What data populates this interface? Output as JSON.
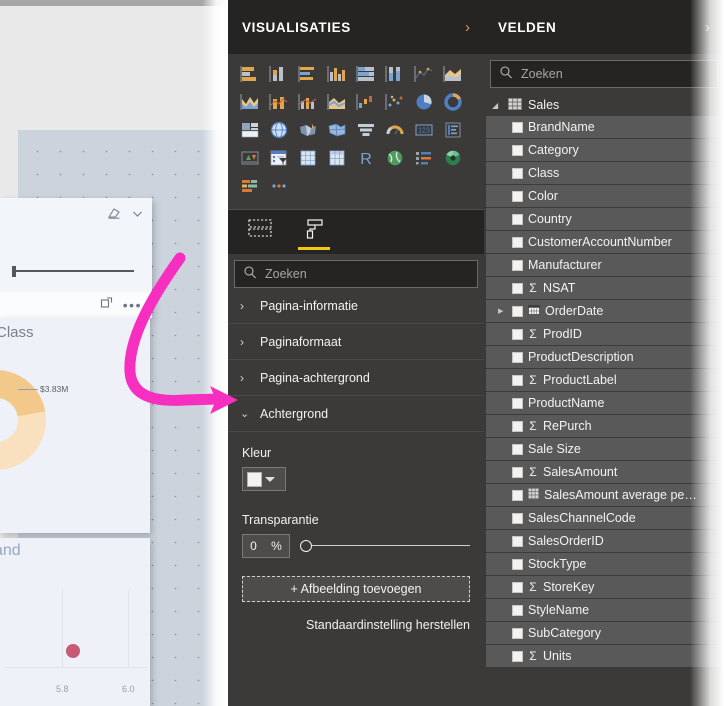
{
  "visualisaties": {
    "title": "VISUALISATIES",
    "collapse_chevron": "›",
    "gallery_icons": [
      "stacked-bar-chart-icon",
      "stacked-column-chart-icon",
      "clustered-bar-chart-icon",
      "clustered-column-chart-icon",
      "hundred-percent-stacked-bar-chart-icon",
      "hundred-percent-stacked-column-chart-icon",
      "line-chart-icon",
      "area-chart-icon",
      "stacked-area-chart-icon",
      "line-stacked-column-chart-icon",
      "line-clustered-column-chart-icon",
      "ribbon-chart-icon",
      "waterfall-chart-icon",
      "scatter-chart-icon",
      "pie-chart-icon",
      "donut-chart-icon",
      "treemap-icon",
      "map-icon",
      "filled-map-icon",
      "shape-map-icon",
      "funnel-chart-icon",
      "gauge-chart-icon",
      "card-icon",
      "multi-row-card-icon",
      "kpi-icon",
      "slicer-icon",
      "table-icon",
      "matrix-icon",
      "r-script-visual-icon",
      "arcgis-map-icon",
      "key-influencers-icon",
      "decomposition-tree-icon",
      "paginated-report-icon",
      "more-options-icon"
    ],
    "tabs": [
      {
        "name": "fields-tab",
        "icon": "fields-pane-icon",
        "active": false
      },
      {
        "name": "format-tab",
        "icon": "paint-roller-icon",
        "active": true
      }
    ],
    "search": {
      "placeholder": "Zoeken",
      "value": "",
      "icon": "search-icon"
    },
    "format_sections": [
      {
        "label": "Pagina-informatie",
        "expanded": false
      },
      {
        "label": "Paginaformaat",
        "expanded": false
      },
      {
        "label": "Pagina-achtergrond",
        "expanded": false
      },
      {
        "label": "Achtergrond",
        "expanded": true
      }
    ],
    "achtergrond": {
      "kleur_label": "Kleur",
      "kleur_value": "#FFFFFF",
      "transparantie_label": "Transparantie",
      "transparantie_value": "0",
      "transparantie_unit": "%",
      "add_image_label": "+ Afbeelding toevoegen",
      "reset_label": "Standaardinstelling herstellen"
    }
  },
  "velden": {
    "title": "VELDEN",
    "collapse_chevron": "›",
    "search": {
      "placeholder": "Zoeken",
      "value": "",
      "icon": "search-icon"
    },
    "table": {
      "name": "Sales",
      "expanded": true,
      "icon": "table-icon"
    },
    "fields": [
      {
        "label": "BrandName",
        "aggregate": false,
        "type": "column"
      },
      {
        "label": "Category",
        "aggregate": false,
        "type": "column"
      },
      {
        "label": "Class",
        "aggregate": false,
        "type": "column"
      },
      {
        "label": "Color",
        "aggregate": false,
        "type": "column"
      },
      {
        "label": "Country",
        "aggregate": false,
        "type": "column"
      },
      {
        "label": "CustomerAccountNumber",
        "aggregate": false,
        "type": "column"
      },
      {
        "label": "Manufacturer",
        "aggregate": false,
        "type": "column"
      },
      {
        "label": "NSAT",
        "aggregate": true,
        "type": "numeric"
      },
      {
        "label": "OrderDate",
        "aggregate": false,
        "type": "date",
        "expandable": true
      },
      {
        "label": "ProdID",
        "aggregate": true,
        "type": "numeric"
      },
      {
        "label": "ProductDescription",
        "aggregate": false,
        "type": "column"
      },
      {
        "label": "ProductLabel",
        "aggregate": true,
        "type": "numeric"
      },
      {
        "label": "ProductName",
        "aggregate": false,
        "type": "column"
      },
      {
        "label": "RePurch",
        "aggregate": true,
        "type": "numeric"
      },
      {
        "label": "Sale Size",
        "aggregate": false,
        "type": "column"
      },
      {
        "label": "SalesAmount",
        "aggregate": true,
        "type": "numeric"
      },
      {
        "label": "SalesAmount average pe…",
        "aggregate": false,
        "type": "measure"
      },
      {
        "label": "SalesChannelCode",
        "aggregate": false,
        "type": "column"
      },
      {
        "label": "SalesOrderID",
        "aggregate": false,
        "type": "column"
      },
      {
        "label": "StockType",
        "aggregate": false,
        "type": "column"
      },
      {
        "label": "StoreKey",
        "aggregate": true,
        "type": "numeric"
      },
      {
        "label": "StyleName",
        "aggregate": false,
        "type": "column"
      },
      {
        "label": "SubCategory",
        "aggregate": false,
        "type": "column"
      },
      {
        "label": "Units",
        "aggregate": true,
        "type": "numeric"
      }
    ]
  },
  "canvas": {
    "slicer": {
      "clear_icon": "eraser-icon",
      "dropdown_icon": "chevron-down-icon",
      "focus_icon": "focus-mode-icon",
      "more_icon": "more-options-icon"
    },
    "donut_chart": {
      "title": "by Class",
      "data_label": "$3.83M"
    },
    "scatter_chart": {
      "title": "Brand",
      "x_ticks": [
        "5.8",
        "6.0"
      ]
    }
  },
  "annotation": {
    "shape": "curved-arrow",
    "color": "#F72FC0"
  },
  "colors": {
    "panel_bg": "#3B3A39",
    "header_bg": "#252423",
    "field_row_bg": "#5A5959",
    "accent_yellow": "#F2C811",
    "annotation_pink": "#F72FC0"
  }
}
